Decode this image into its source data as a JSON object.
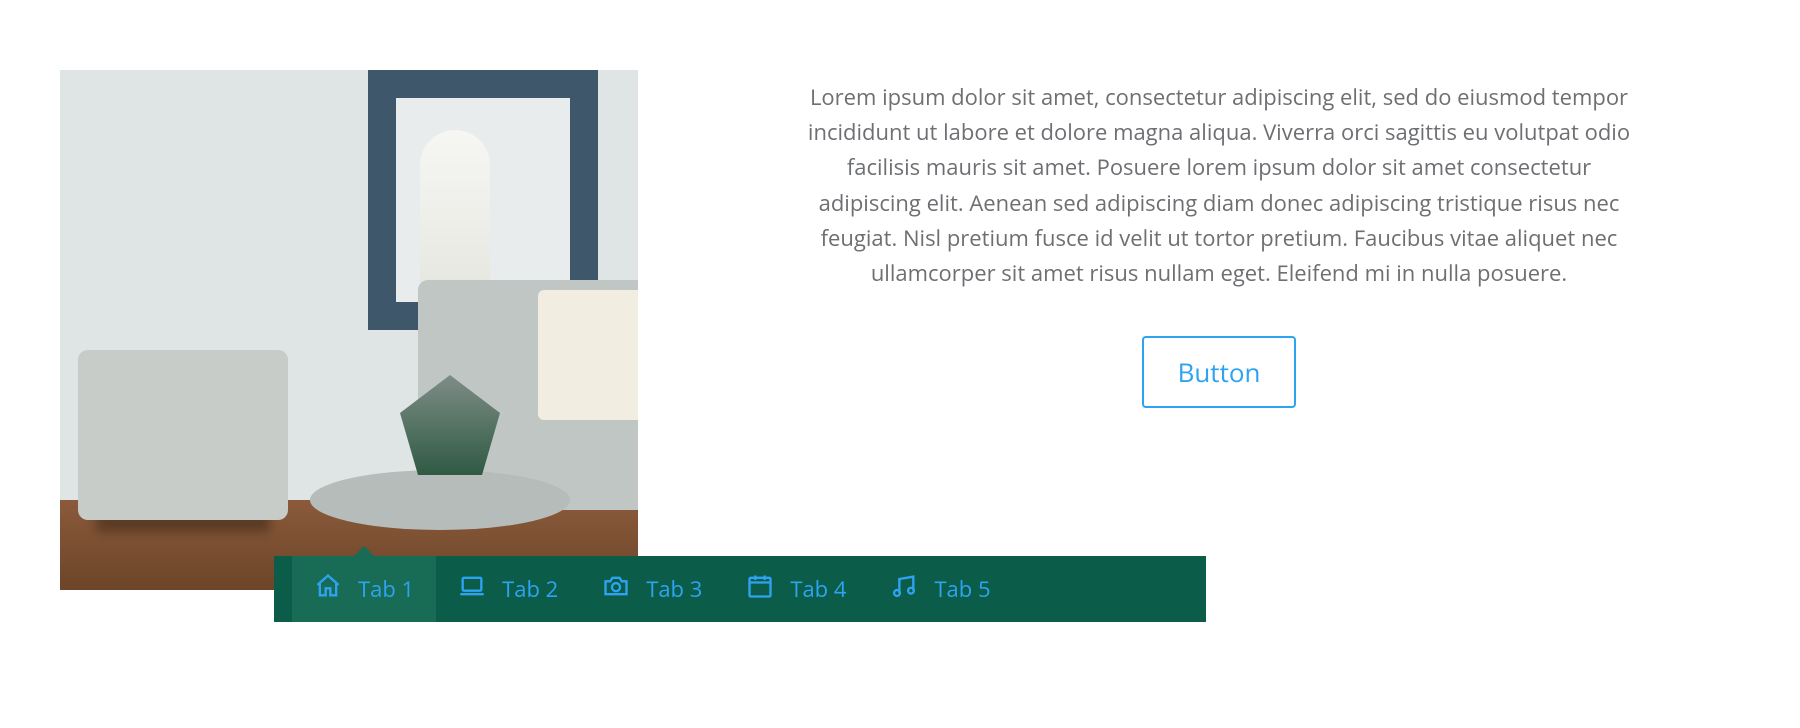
{
  "content": {
    "paragraph": "Lorem ipsum dolor sit amet, consectetur adipiscing elit, sed do eiusmod tempor incididunt ut labore et dolore magna aliqua. Viverra orci sagittis eu volutpat odio facilisis mauris sit amet. Posuere lorem ipsum dolor sit amet consectetur adipiscing elit. Aenean sed adipiscing diam donec adipiscing tristique risus nec feugiat. Nisl pretium fusce id velit ut tortor pretium. Faucibus vitae aliquet nec ullamcorper sit amet risus nullam eget. Eleifend mi in nulla posuere.",
    "button_label": "Button"
  },
  "tabs": {
    "active_index": 0,
    "items": [
      {
        "label": "Tab 1",
        "icon": "home-icon"
      },
      {
        "label": "Tab 2",
        "icon": "laptop-icon"
      },
      {
        "label": "Tab 3",
        "icon": "camera-icon"
      },
      {
        "label": "Tab 4",
        "icon": "calendar-icon"
      },
      {
        "label": "Tab 5",
        "icon": "music-icon"
      }
    ]
  },
  "colors": {
    "accent": "#2ea3f2",
    "tab_bg": "#0b5d4a",
    "tab_active_bg": "#186b55",
    "body_text": "#6d6f72"
  }
}
